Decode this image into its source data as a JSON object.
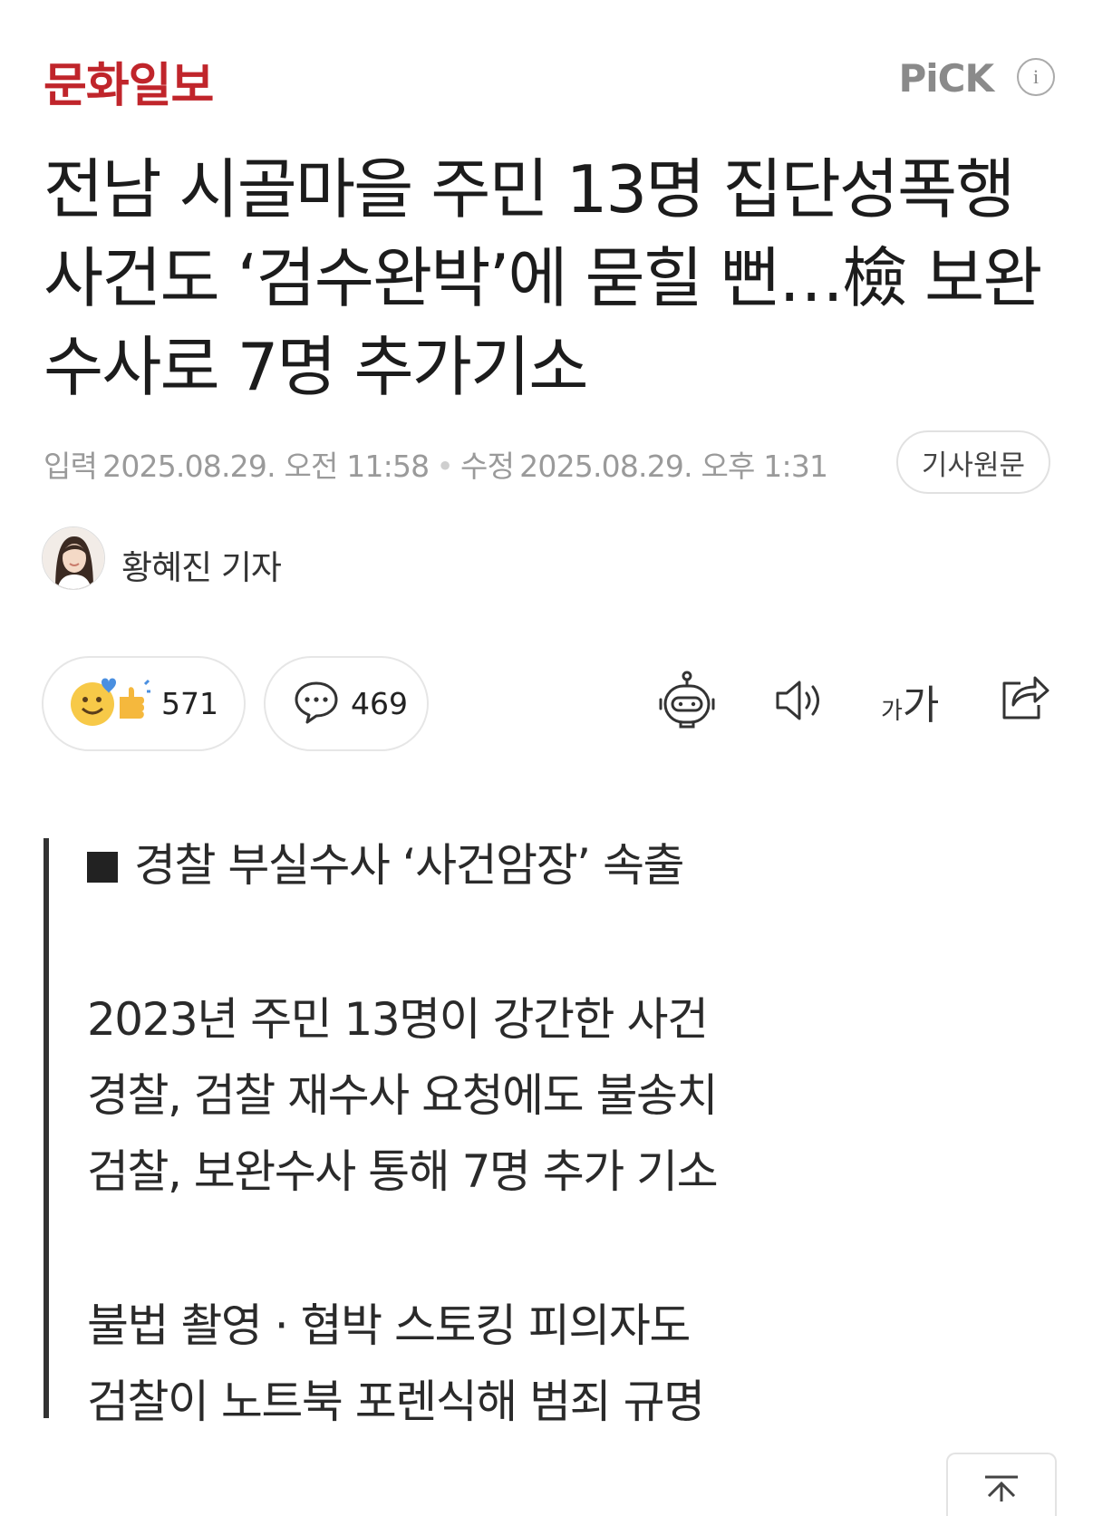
{
  "header": {
    "brand": "문화일보",
    "brand_color": "#c0252b",
    "pick_label": "PiCK",
    "info_label": "i"
  },
  "article": {
    "title": "전남 시골마을 주민 13명 집단성폭행 사건도 ‘검수완박’에 묻힐 뻔…檢 보완수사로 7명 추가기소",
    "meta": {
      "input_label": "입력",
      "input_time": "2025.08.29. 오전 11:58",
      "modified_label": "수정",
      "modified_time": "2025.08.29. 오후 1:31",
      "separator": "•",
      "original_button": "기사원문"
    },
    "author": "황혜진 기자"
  },
  "actions": {
    "reaction_count": "571",
    "comment_count": "469",
    "font_size_label_small": "가",
    "font_size_label_large": "가"
  },
  "lead": {
    "lines": [
      "경찰 부실수사 ‘사건암장’ 속출",
      "2023년 주민 13명이 강간한 사건",
      "경찰, 검찰 재수사 요청에도 불송치",
      "검찰, 보완수사 통해 7명 추가 기소",
      "불법 촬영 · 협박 스토킹 피의자도",
      "검찰이 노트북 포렌식해 범죄 규명"
    ]
  },
  "icons": {
    "info": "info-icon",
    "avatar": "author-avatar",
    "reaction": "like-emoji-icon",
    "comment": "comment-bubble-icon",
    "summary_bot": "robot-icon",
    "tts": "speaker-icon",
    "font_size": "font-size-icon",
    "share": "share-icon",
    "scroll_top": "scroll-top-icon"
  }
}
